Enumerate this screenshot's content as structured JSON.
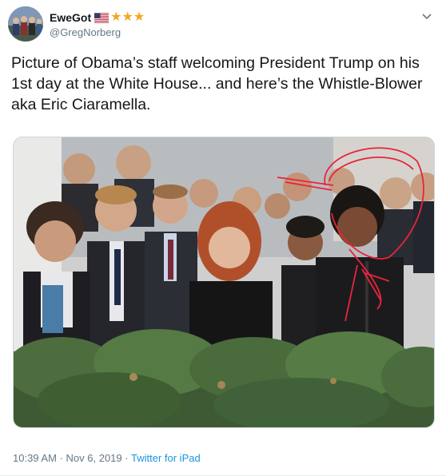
{
  "author": {
    "display_name": "EweGot",
    "handle": "@GregNorberg",
    "name_emoji": [
      "us-flag-icon",
      "star-icon",
      "star-icon",
      "star-icon"
    ],
    "star_color": "#f5a623"
  },
  "tweet": {
    "text": "Picture of Obama’s staff welcoming President Trump on his 1st day at the White House... and here’s the Whistle-Blower aka Eric Ciaramella."
  },
  "media": {
    "type": "photo",
    "annotation_color": "#e8253a"
  },
  "meta": {
    "time": "10:39 AM",
    "separator": "·",
    "date": "Nov 6, 2019",
    "separator2": "·",
    "source": "Twitter for iPad"
  },
  "colors": {
    "text_primary": "#14171a",
    "text_secondary": "#657786",
    "link": "#1b95e0"
  }
}
